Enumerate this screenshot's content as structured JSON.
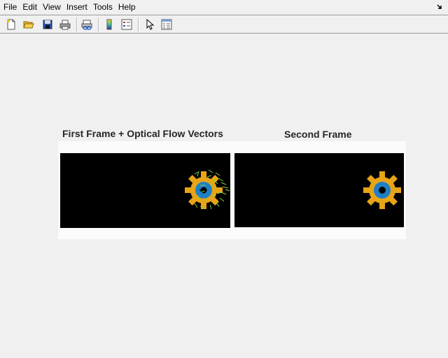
{
  "menubar": {
    "items": [
      "File",
      "Edit",
      "View",
      "Insert",
      "Tools",
      "Help"
    ]
  },
  "toolbar": {
    "buttons": [
      {
        "name": "new-figure",
        "icon": "new-document-icon"
      },
      {
        "name": "open-file",
        "icon": "folder-open-icon"
      },
      {
        "name": "save-figure",
        "icon": "floppy-disk-icon"
      },
      {
        "name": "print-figure",
        "icon": "printer-icon"
      },
      {
        "name": "link-plot",
        "icon": "link-plot-icon"
      },
      {
        "name": "insert-colorbar",
        "icon": "colorbar-icon"
      },
      {
        "name": "insert-legend",
        "icon": "legend-icon"
      },
      {
        "name": "edit-plot",
        "icon": "arrow-cursor-icon"
      },
      {
        "name": "property-inspector",
        "icon": "property-inspector-icon"
      }
    ]
  },
  "figure": {
    "left_title": "First Frame + Optical Flow Vectors",
    "right_title": "Second Frame"
  },
  "colors": {
    "gear": "#e8a417",
    "gear_inner": "#1f7fc6",
    "flow_vectors": "#7fd13b",
    "frame_bg": "#000000"
  }
}
